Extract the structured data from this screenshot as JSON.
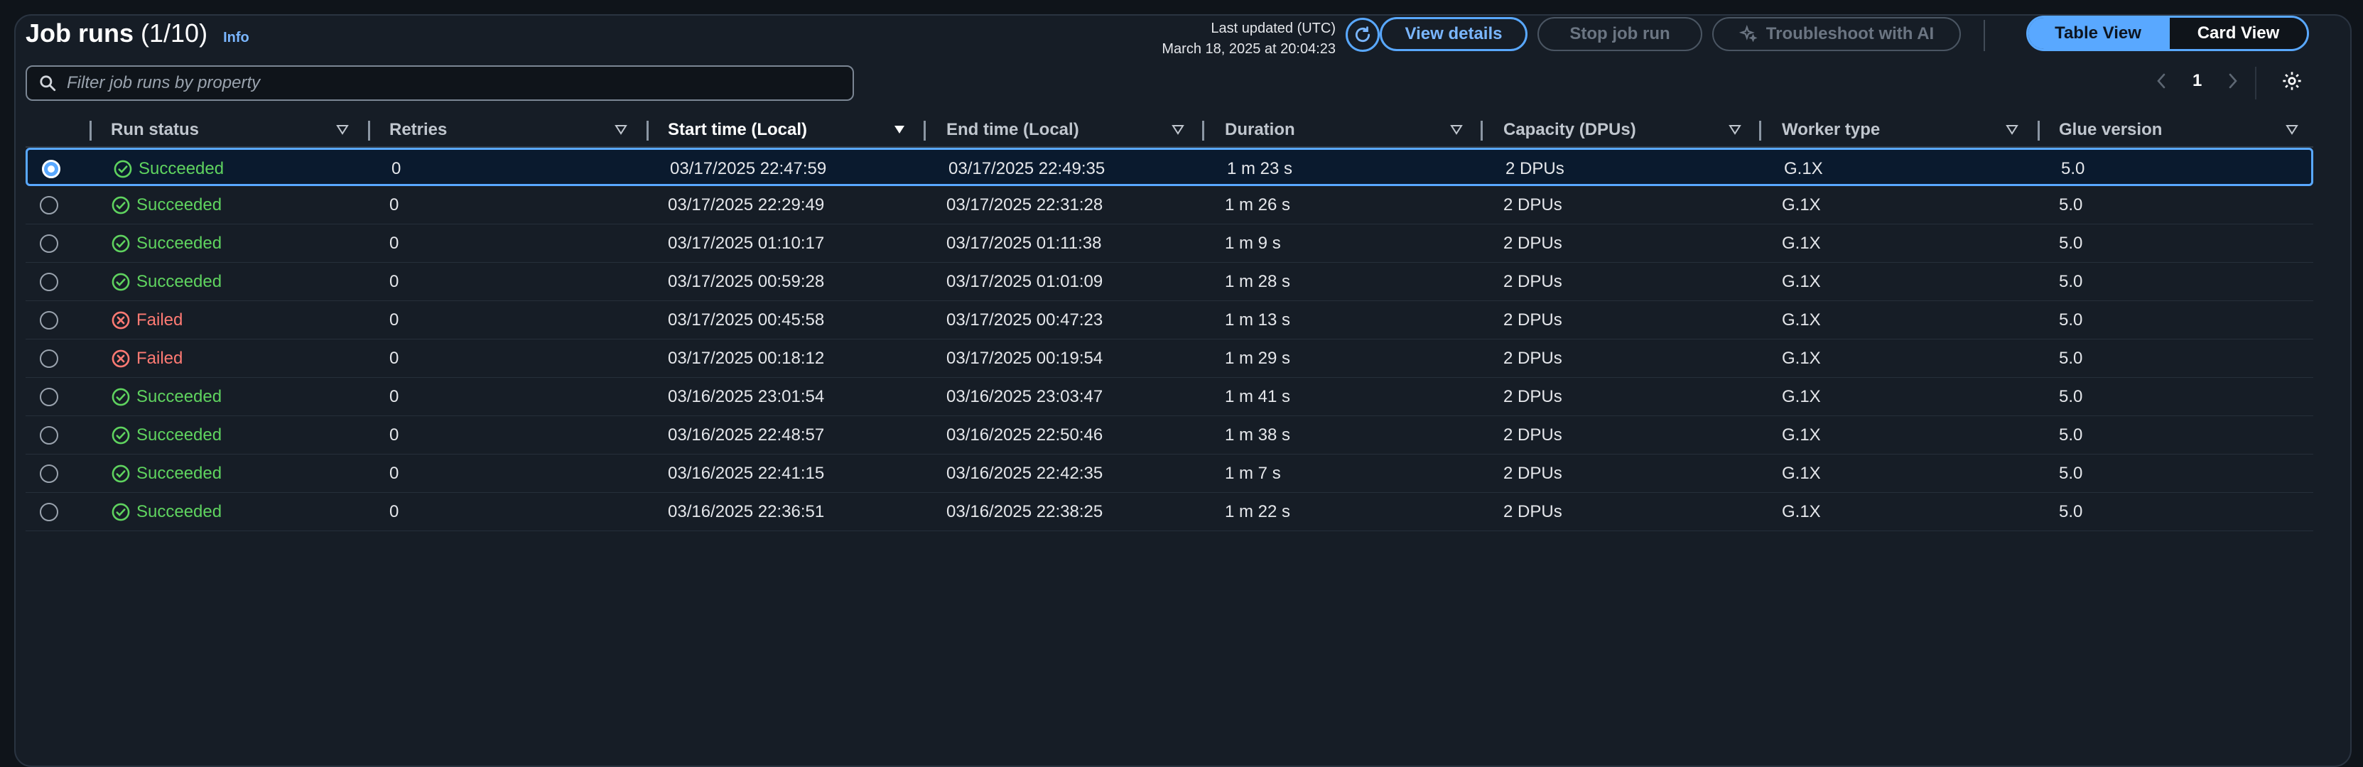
{
  "header": {
    "title": "Job runs",
    "count": "(1/10)",
    "info_link": "Info",
    "last_updated_label": "Last updated (UTC)",
    "last_updated_value": "March 18, 2025 at 20:04:23",
    "view_details": "View details",
    "stop_job_run": "Stop job run",
    "troubleshoot": "Troubleshoot with AI",
    "table_view": "Table View",
    "card_view": "Card View"
  },
  "search": {
    "placeholder": "Filter job runs by property"
  },
  "pagination": {
    "current_page": "1"
  },
  "colors": {
    "accent": "#59a8ff",
    "success": "#5fd35f",
    "failed": "#ff7a73"
  },
  "table": {
    "columns": [
      "Run status",
      "Retries",
      "Start time (Local)",
      "End time (Local)",
      "Duration",
      "Capacity (DPUs)",
      "Worker type",
      "Glue version"
    ],
    "sorted_column": "Start time (Local)",
    "selected_row": 0,
    "rows": [
      {
        "status": "Succeeded",
        "retries": "0",
        "start": "03/17/2025 22:47:59",
        "end": "03/17/2025 22:49:35",
        "duration": "1 m 23 s",
        "capacity": "2 DPUs",
        "worker": "G.1X",
        "glue": "5.0"
      },
      {
        "status": "Succeeded",
        "retries": "0",
        "start": "03/17/2025 22:29:49",
        "end": "03/17/2025 22:31:28",
        "duration": "1 m 26 s",
        "capacity": "2 DPUs",
        "worker": "G.1X",
        "glue": "5.0"
      },
      {
        "status": "Succeeded",
        "retries": "0",
        "start": "03/17/2025 01:10:17",
        "end": "03/17/2025 01:11:38",
        "duration": "1 m 9 s",
        "capacity": "2 DPUs",
        "worker": "G.1X",
        "glue": "5.0"
      },
      {
        "status": "Succeeded",
        "retries": "0",
        "start": "03/17/2025 00:59:28",
        "end": "03/17/2025 01:01:09",
        "duration": "1 m 28 s",
        "capacity": "2 DPUs",
        "worker": "G.1X",
        "glue": "5.0"
      },
      {
        "status": "Failed",
        "retries": "0",
        "start": "03/17/2025 00:45:58",
        "end": "03/17/2025 00:47:23",
        "duration": "1 m 13 s",
        "capacity": "2 DPUs",
        "worker": "G.1X",
        "glue": "5.0"
      },
      {
        "status": "Failed",
        "retries": "0",
        "start": "03/17/2025 00:18:12",
        "end": "03/17/2025 00:19:54",
        "duration": "1 m 29 s",
        "capacity": "2 DPUs",
        "worker": "G.1X",
        "glue": "5.0"
      },
      {
        "status": "Succeeded",
        "retries": "0",
        "start": "03/16/2025 23:01:54",
        "end": "03/16/2025 23:03:47",
        "duration": "1 m 41 s",
        "capacity": "2 DPUs",
        "worker": "G.1X",
        "glue": "5.0"
      },
      {
        "status": "Succeeded",
        "retries": "0",
        "start": "03/16/2025 22:48:57",
        "end": "03/16/2025 22:50:46",
        "duration": "1 m 38 s",
        "capacity": "2 DPUs",
        "worker": "G.1X",
        "glue": "5.0"
      },
      {
        "status": "Succeeded",
        "retries": "0",
        "start": "03/16/2025 22:41:15",
        "end": "03/16/2025 22:42:35",
        "duration": "1 m 7 s",
        "capacity": "2 DPUs",
        "worker": "G.1X",
        "glue": "5.0"
      },
      {
        "status": "Succeeded",
        "retries": "0",
        "start": "03/16/2025 22:36:51",
        "end": "03/16/2025 22:38:25",
        "duration": "1 m 22 s",
        "capacity": "2 DPUs",
        "worker": "G.1X",
        "glue": "5.0"
      }
    ]
  }
}
